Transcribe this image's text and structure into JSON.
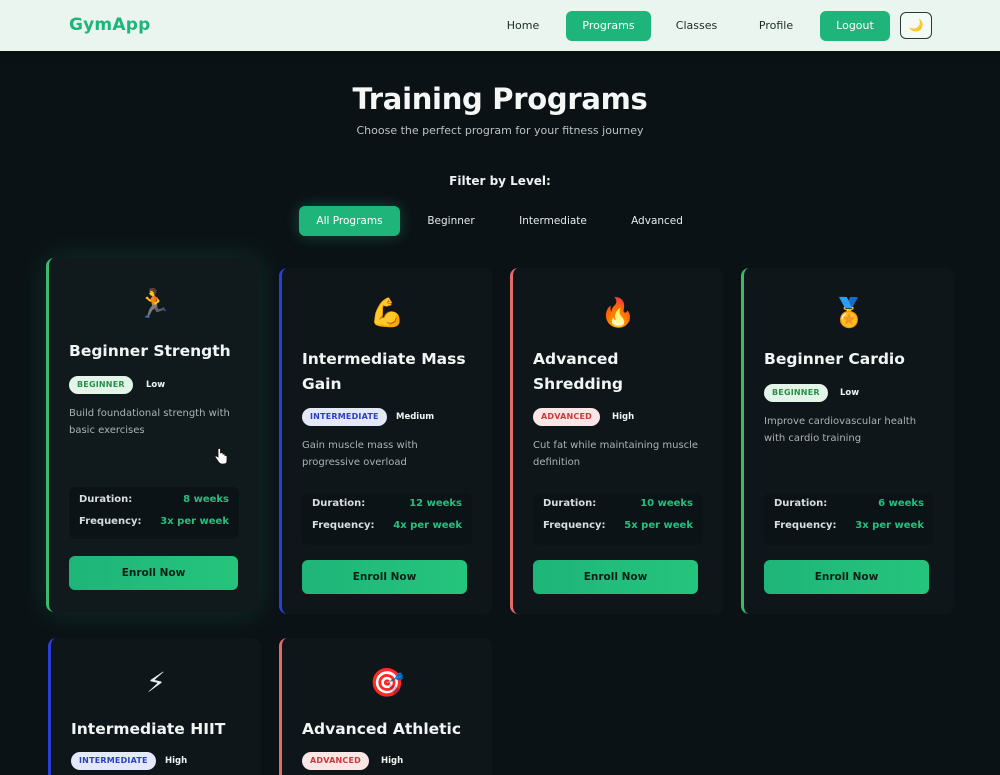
{
  "nav": {
    "brand": "GymApp",
    "links": [
      "Home",
      "Programs",
      "Classes",
      "Profile"
    ],
    "logout": "Logout",
    "theme_icon": "moon-icon",
    "theme_glyph": "🌙",
    "accent": "#1fb57a"
  },
  "header": {
    "title": "Training Programs",
    "subtitle": "Choose the perfect program for your fitness journey"
  },
  "filter": {
    "label": "Filter by Level:",
    "options": [
      "All Programs",
      "Beginner",
      "Intermediate",
      "Advanced"
    ],
    "selected": "All Programs"
  },
  "programs": [
    {
      "emoji": "🏃",
      "icon": "runner-icon",
      "title": "Beginner Strength",
      "level": "BEGINNER",
      "intensity": "Low",
      "description": "Build foundational strength with basic exercises",
      "duration_label": "Duration:",
      "duration": "8 weeks",
      "frequency_label": "Frequency:",
      "frequency": "3x per week",
      "cta": "Enroll Now"
    },
    {
      "emoji": "💪",
      "icon": "flexed-biceps-icon",
      "title": "Intermediate Mass Gain",
      "level": "INTERMEDIATE",
      "intensity": "Medium",
      "description": "Gain muscle mass with progressive overload",
      "duration_label": "Duration:",
      "duration": "12 weeks",
      "frequency_label": "Frequency:",
      "frequency": "4x per week",
      "cta": "Enroll Now"
    },
    {
      "emoji": "🔥",
      "icon": "fire-icon",
      "title": "Advanced Shredding",
      "level": "ADVANCED",
      "intensity": "High",
      "description": "Cut fat while maintaining muscle definition",
      "duration_label": "Duration:",
      "duration": "10 weeks",
      "frequency_label": "Frequency:",
      "frequency": "5x per week",
      "cta": "Enroll Now"
    },
    {
      "emoji": "🏅",
      "icon": "medal-icon",
      "title": "Beginner Cardio",
      "level": "BEGINNER",
      "intensity": "Low",
      "description": "Improve cardiovascular health with cardio training",
      "duration_label": "Duration:",
      "duration": "6 weeks",
      "frequency_label": "Frequency:",
      "frequency": "3x per week",
      "cta": "Enroll Now"
    },
    {
      "emoji": "⚡",
      "icon": "lightning-icon",
      "title": "Intermediate HIIT",
      "level": "INTERMEDIATE",
      "intensity": "High"
    },
    {
      "emoji": "🎯",
      "icon": "target-icon",
      "title": "Advanced Athletic",
      "level": "ADVANCED",
      "intensity": "High"
    }
  ]
}
